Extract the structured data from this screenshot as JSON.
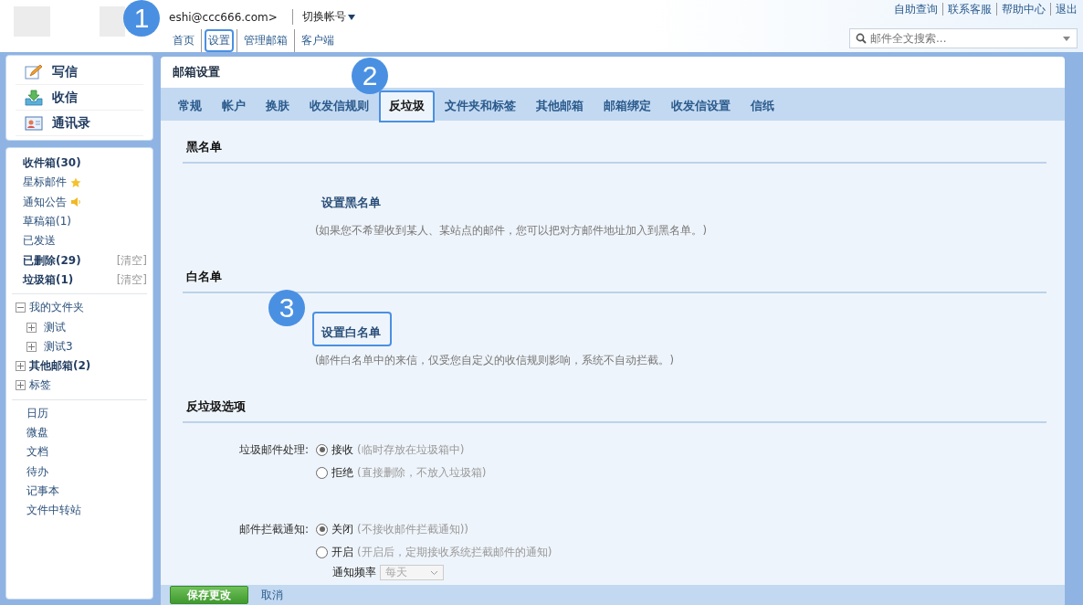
{
  "header": {
    "account": "eshi@ccc666.com>",
    "switch_account": "切换帐号",
    "nav": [
      {
        "label": "首页",
        "highlighted": false
      },
      {
        "label": "设置",
        "highlighted": true,
        "callout": "1"
      },
      {
        "label": "管理邮箱",
        "highlighted": false
      },
      {
        "label": "客户端",
        "highlighted": false
      }
    ],
    "links": [
      "自助查询",
      "联系客服",
      "帮助中心",
      "退出"
    ],
    "search": {
      "placeholder": "邮件全文搜索..."
    }
  },
  "actions": [
    {
      "label": "写信"
    },
    {
      "label": "收信"
    },
    {
      "label": "通讯录"
    }
  ],
  "folders": [
    {
      "label": "收件箱(30)",
      "bold": true,
      "kind": "plain"
    },
    {
      "label": "星标邮件",
      "bold": false,
      "kind": "starred"
    },
    {
      "label": "通知公告",
      "bold": false,
      "kind": "notice"
    },
    {
      "label": "草稿箱(1)",
      "bold": false,
      "kind": "plain"
    },
    {
      "label": "已发送",
      "bold": false,
      "kind": "plain"
    },
    {
      "label": "已删除(29)",
      "bold": true,
      "kind": "plain",
      "action": "[清空]"
    },
    {
      "label": "垃圾箱(1)",
      "bold": true,
      "kind": "plain",
      "action": "[清空]"
    }
  ],
  "tree": [
    {
      "label": "我的文件夹",
      "bold": false,
      "expanded": true,
      "children": [
        {
          "label": "测试",
          "bold": false,
          "expanded": false
        },
        {
          "label": "测试3",
          "bold": false,
          "expanded": false
        }
      ]
    },
    {
      "label": "其他邮箱(2)",
      "bold": true,
      "expanded": false
    },
    {
      "label": "标签",
      "bold": false,
      "expanded": false
    }
  ],
  "tools": [
    "日历",
    "微盘",
    "文档",
    "待办",
    "记事本",
    "文件中转站"
  ],
  "settings": {
    "title": "邮箱设置",
    "tabs": [
      {
        "label": "常规",
        "selected": false,
        "highlighted": false
      },
      {
        "label": "帐户",
        "selected": false,
        "highlighted": false
      },
      {
        "label": "换肤",
        "selected": false,
        "highlighted": false
      },
      {
        "label": "收发信规则",
        "selected": false,
        "highlighted": false
      },
      {
        "label": "反垃圾",
        "selected": true,
        "highlighted": true,
        "callout": "2"
      },
      {
        "label": "文件夹和标签",
        "selected": false,
        "highlighted": false
      },
      {
        "label": "其他邮箱",
        "selected": false,
        "highlighted": false
      },
      {
        "label": "邮箱绑定",
        "selected": false,
        "highlighted": false
      },
      {
        "label": "收发信设置",
        "selected": false,
        "highlighted": false
      },
      {
        "label": "信纸",
        "selected": false,
        "highlighted": false
      }
    ],
    "sections": [
      {
        "kind": "link",
        "heading": "黑名单",
        "link": {
          "label": "设置黑名单",
          "highlighted": false
        },
        "description": "(如果您不希望收到某人、某站点的邮件，您可以把对方邮件地址加入到黑名单。)"
      },
      {
        "kind": "link",
        "heading": "白名单",
        "link": {
          "label": "设置白名单",
          "highlighted": true,
          "callout": "3"
        },
        "description": "(邮件白名单中的来信，仅受您自定义的收信规则影响，系统不自动拦截。)"
      },
      {
        "kind": "options",
        "heading": "反垃圾选项",
        "groups": [
          {
            "label": "垃圾邮件处理:",
            "options": [
              {
                "label": "接收",
                "hint": "(临时存放在垃圾箱中)",
                "selected": true
              },
              {
                "label": "拒绝",
                "hint": "(直接删除，不放入垃圾箱)",
                "selected": false
              }
            ]
          },
          {
            "label": "邮件拦截通知:",
            "options": [
              {
                "label": "关闭",
                "hint": "(不接收邮件拦截通知))",
                "selected": true
              },
              {
                "label": "开启",
                "hint": "(开启后，定期接收系统拦截邮件的通知)",
                "selected": false
              }
            ],
            "frequency": {
              "label": "通知频率",
              "value": "每天",
              "disabled": true
            }
          }
        ]
      }
    ],
    "buttons": {
      "save": "保存更改",
      "cancel": "取消"
    }
  }
}
